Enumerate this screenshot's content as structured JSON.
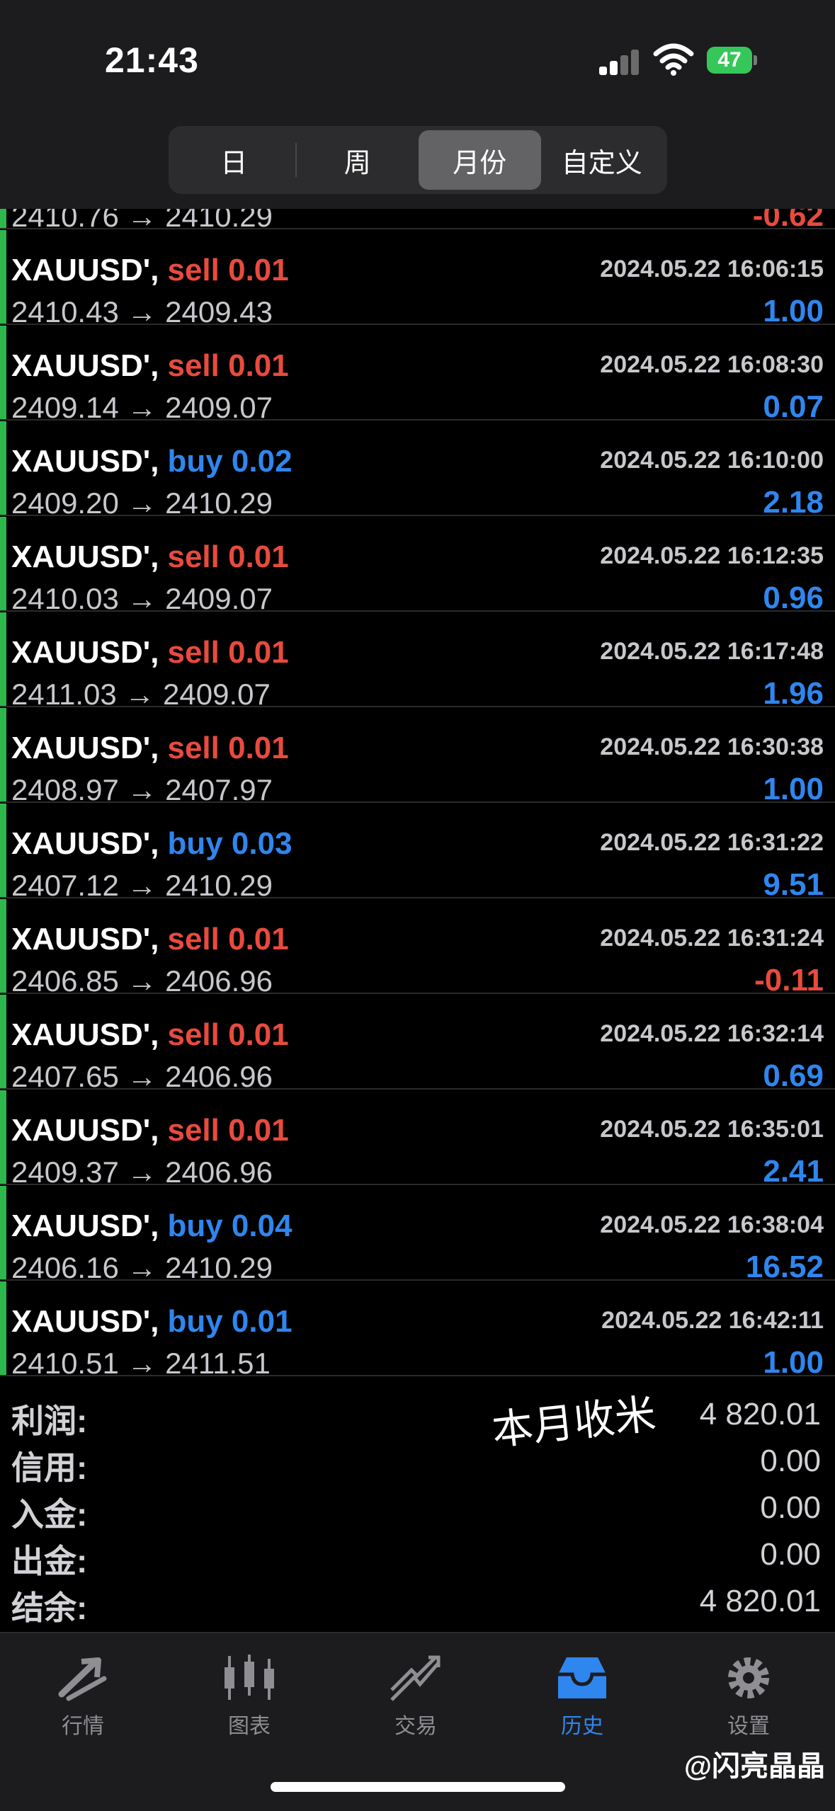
{
  "status": {
    "time": "21:43",
    "battery": "47"
  },
  "segments": [
    {
      "label": "日",
      "active": false
    },
    {
      "label": "周",
      "active": false
    },
    {
      "label": "月份",
      "active": true
    },
    {
      "label": "自定义",
      "active": false
    }
  ],
  "partial_row": {
    "prices": "2410.76 → 2410.29",
    "pl": "-0.62"
  },
  "deals": [
    {
      "symbol": "XAUUSD',",
      "side": "sell 0.01",
      "type": "sell",
      "datetime": "2024.05.22 16:06:15",
      "prices": "2410.43 → 2409.43",
      "pl": "1.00"
    },
    {
      "symbol": "XAUUSD',",
      "side": "sell 0.01",
      "type": "sell",
      "datetime": "2024.05.22 16:08:30",
      "prices": "2409.14 → 2409.07",
      "pl": "0.07"
    },
    {
      "symbol": "XAUUSD',",
      "side": "buy 0.02",
      "type": "buy",
      "datetime": "2024.05.22 16:10:00",
      "prices": "2409.20 → 2410.29",
      "pl": "2.18"
    },
    {
      "symbol": "XAUUSD',",
      "side": "sell 0.01",
      "type": "sell",
      "datetime": "2024.05.22 16:12:35",
      "prices": "2410.03 → 2409.07",
      "pl": "0.96"
    },
    {
      "symbol": "XAUUSD',",
      "side": "sell 0.01",
      "type": "sell",
      "datetime": "2024.05.22 16:17:48",
      "prices": "2411.03 → 2409.07",
      "pl": "1.96"
    },
    {
      "symbol": "XAUUSD',",
      "side": "sell 0.01",
      "type": "sell",
      "datetime": "2024.05.22 16:30:38",
      "prices": "2408.97 → 2407.97",
      "pl": "1.00"
    },
    {
      "symbol": "XAUUSD',",
      "side": "buy 0.03",
      "type": "buy",
      "datetime": "2024.05.22 16:31:22",
      "prices": "2407.12 → 2410.29",
      "pl": "9.51"
    },
    {
      "symbol": "XAUUSD',",
      "side": "sell 0.01",
      "type": "sell",
      "datetime": "2024.05.22 16:31:24",
      "prices": "2406.85 → 2406.96",
      "pl": "-0.11"
    },
    {
      "symbol": "XAUUSD',",
      "side": "sell 0.01",
      "type": "sell",
      "datetime": "2024.05.22 16:32:14",
      "prices": "2407.65 → 2406.96",
      "pl": "0.69"
    },
    {
      "symbol": "XAUUSD',",
      "side": "sell 0.01",
      "type": "sell",
      "datetime": "2024.05.22 16:35:01",
      "prices": "2409.37 → 2406.96",
      "pl": "2.41"
    },
    {
      "symbol": "XAUUSD',",
      "side": "buy 0.04",
      "type": "buy",
      "datetime": "2024.05.22 16:38:04",
      "prices": "2406.16 → 2410.29",
      "pl": "16.52"
    },
    {
      "symbol": "XAUUSD',",
      "side": "buy 0.01",
      "type": "buy",
      "datetime": "2024.05.22 16:42:11",
      "prices": "2410.51 → 2411.51",
      "pl": "1.00"
    }
  ],
  "summary": [
    {
      "label": "利润:",
      "value": "4 820.01"
    },
    {
      "label": "信用:",
      "value": "0.00"
    },
    {
      "label": "入金:",
      "value": "0.00"
    },
    {
      "label": "出金:",
      "value": "0.00"
    },
    {
      "label": "结余:",
      "value": "4 820.01"
    }
  ],
  "note": "本月收米",
  "tabs": [
    {
      "label": "行情",
      "icon": "quotes-icon",
      "active": false
    },
    {
      "label": "图表",
      "icon": "chart-icon",
      "active": false
    },
    {
      "label": "交易",
      "icon": "trade-icon",
      "active": false
    },
    {
      "label": "历史",
      "icon": "history-icon",
      "active": true
    },
    {
      "label": "设置",
      "icon": "settings-icon",
      "active": false
    }
  ],
  "watermark": "@闪亮晶晶",
  "colors": {
    "sell": "#e84b3c",
    "buy": "#2f86ee",
    "positive": "#2f86ee",
    "negative": "#e84b3c",
    "accent_bar": "#2db84b"
  }
}
